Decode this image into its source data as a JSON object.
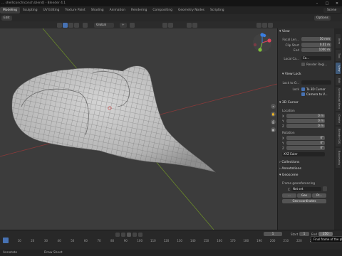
{
  "title": "... shell\\conch\\conch.blend] - Blender 4.1",
  "window_controls": [
    "–",
    "□",
    "✕"
  ],
  "workspaces": [
    "Modeling",
    "Sculpting",
    "UV Editing",
    "Texture Paint",
    "Shading",
    "Animation",
    "Rendering",
    "Compositing",
    "Geometry Nodes",
    "Scripting"
  ],
  "active_workspace": "Modeling",
  "scene": "Scene",
  "header": {
    "mode": "Edit",
    "options": "Options"
  },
  "tool_header": {
    "orientation": "Global",
    "tool": "+"
  },
  "sidebar": {
    "view_header": "View",
    "focal_label": "Focal Len...",
    "focal_value": "50 mm",
    "clip_start_label": "Clip Start",
    "clip_start_value": "0.01 m",
    "end_label": "End",
    "end_value": "1000 m",
    "local_camera_label": "Local Ca...",
    "local_camera_value": "Ca...",
    "render_region": "Render Regi...",
    "view_lock_header": "View Lock",
    "lock_to_object_label": "Lock to O...",
    "lock_label": "Lock",
    "to_3d_cursor": "To 3D Cursor",
    "camera_to_view": "Camera to V...",
    "cursor_header": "3D Cursor",
    "location_label": "Location",
    "loc_x_label": "X",
    "loc_x": "0 m",
    "loc_y_label": "Y",
    "loc_y": "0 m",
    "loc_z_label": "Z",
    "loc_z": "0 m",
    "rotation_label": "Rotation",
    "rot_x_label": "X",
    "rot_x": "0°",
    "rot_y_label": "Y",
    "rot_y": "0°",
    "rot_z_label": "Z",
    "rot_z": "0°",
    "rot_mode": "XYZ Euler",
    "collections_header": "Collections",
    "annotations_header": "Annotations",
    "geoscene_header": "Geoscene",
    "frame_georef_label": "Frame georeferencing",
    "crs_label": "C",
    "crs_value": "Not set",
    "geo_btn1": "...",
    "geo_btn2": "Geo",
    "geo_btn3": "Pr...",
    "geo_coords_btn": "Geo-coordinates"
  },
  "tabs": [
    "Item",
    "Tool",
    "View",
    "Edit",
    "Screencast Keys",
    "Create",
    "Blender GIS",
    "Bookmarks"
  ],
  "timeline": {
    "current_frame": "1",
    "start_label": "Start",
    "start": "1",
    "end_label": "End",
    "end": "250",
    "ruler": [
      "0",
      "10",
      "20",
      "30",
      "40",
      "50",
      "60",
      "70",
      "80",
      "90",
      "100",
      "110",
      "120",
      "130",
      "140",
      "150",
      "160",
      "170",
      "180",
      "190",
      "200",
      "210",
      "220",
      "230",
      "240",
      "250"
    ],
    "tooltip": "Final frame of the pl..."
  },
  "status": {
    "left": "Annotate",
    "middle": "Draw Sheet"
  },
  "colors": {
    "x_axis": "#8b3a3a",
    "y_axis": "#6a8a2a",
    "accent": "#4772b3",
    "gizmo_x": "#e0435a",
    "gizmo_y": "#7fbf3a",
    "gizmo_z": "#3a7ee0"
  }
}
